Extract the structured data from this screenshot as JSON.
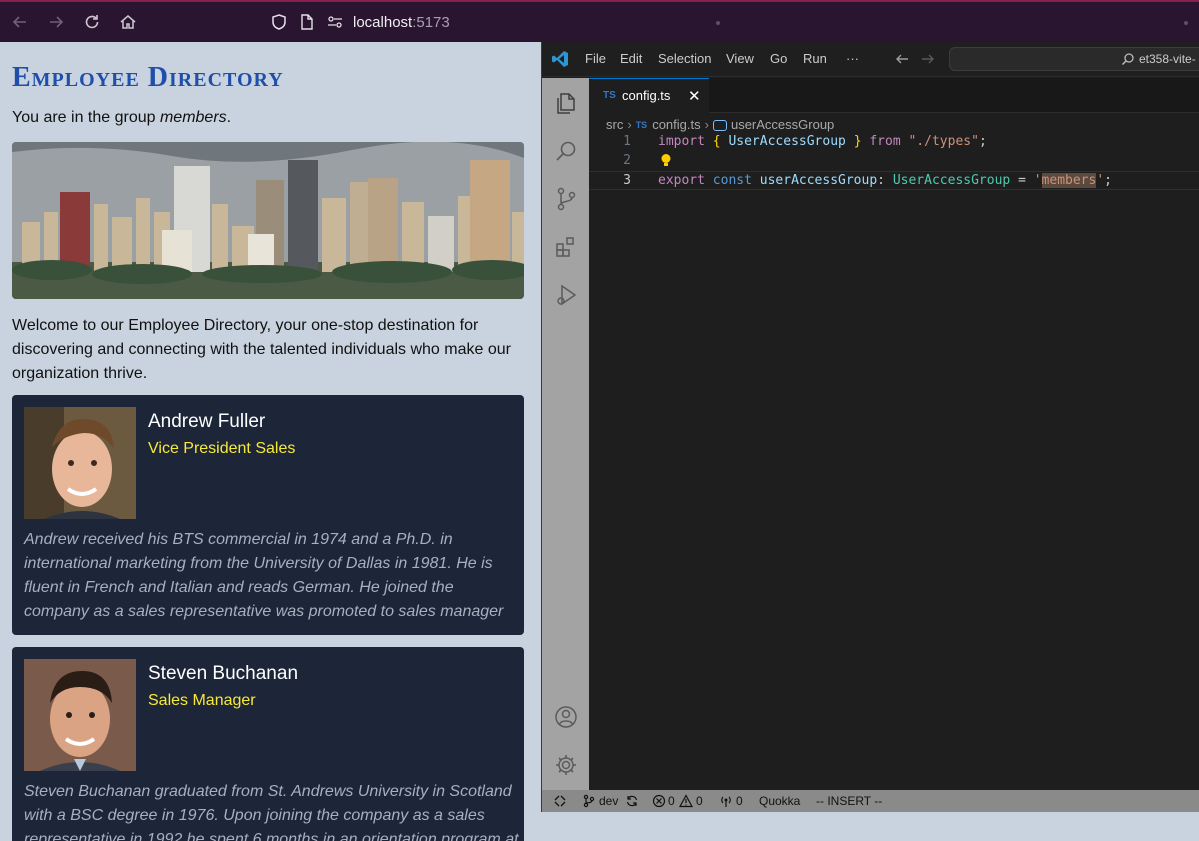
{
  "browser": {
    "url_host": "localhost",
    "url_port": ":5173"
  },
  "page": {
    "title": "Employee Directory",
    "group_prefix": "You are in the group ",
    "group_name": "members",
    "group_suffix": ".",
    "welcome": "Welcome to our Employee Directory, your one-stop destination for discovering and connecting with the talented individuals who make our organization thrive.",
    "employees": [
      {
        "name": "Andrew Fuller",
        "title": "Vice President Sales",
        "bio": "Andrew received his BTS commercial in 1974 and a Ph.D. in international marketing from the University of Dallas in 1981. He is fluent in French and Italian and reads German. He joined the company as a sales representative was promoted to sales manager"
      },
      {
        "name": "Steven Buchanan",
        "title": "Sales Manager",
        "bio": "Steven Buchanan graduated from St. Andrews University in Scotland with a BSC degree in 1976. Upon joining the company as a sales representative in 1992 he spent 6 months in an orientation program at"
      }
    ]
  },
  "vscode": {
    "menu": [
      "File",
      "Edit",
      "Selection",
      "View",
      "Go",
      "Run",
      "···"
    ],
    "command_center": "et358-vite-",
    "tab": {
      "badge": "TS",
      "label": "config.ts",
      "close": "✕"
    },
    "breadcrumbs": {
      "folder": "src",
      "file": "config.ts",
      "symbol": "userAccessGroup",
      "file_badge": "TS"
    },
    "code": {
      "line_numbers": [
        "1",
        "2",
        "3"
      ],
      "line1": {
        "kw": "import",
        "open": "{",
        "ident": "UserAccessGroup",
        "close": "}",
        "from": "from",
        "path": "\"./types\"",
        "semi": ";"
      },
      "line3": {
        "export": "export",
        "const": "const",
        "name": "userAccessGroup",
        "colon": ":",
        "type": "UserAccessGroup",
        "eq": "=",
        "q1": "'",
        "value": "members",
        "q2": "'",
        "semi": ";"
      }
    },
    "status": {
      "branch": "dev",
      "errors": "0",
      "warnings": "0",
      "ports": "0",
      "quokka": "Quokka",
      "mode": "-- INSERT --"
    },
    "colors": {
      "accent": "#0078d4",
      "activity_bar": "#a3a3a3",
      "status_bar": "#8a8a8a"
    }
  }
}
